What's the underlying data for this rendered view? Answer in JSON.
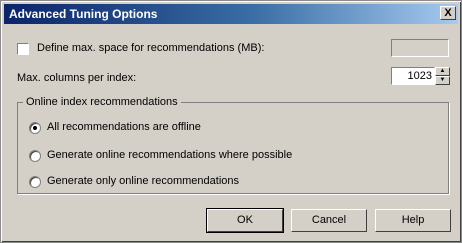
{
  "dialog": {
    "title": "Advanced Tuning Options",
    "close_label": "X"
  },
  "space_option": {
    "label": "Define max. space for recommendations (MB):",
    "checked": false,
    "value": ""
  },
  "columns_option": {
    "label": "Max. columns per index:",
    "value": "1023",
    "up_arrow": "▲",
    "down_arrow": "▼"
  },
  "online_group": {
    "title": "Online index recommendations",
    "options": [
      {
        "label": "All recommendations are offline",
        "selected": true
      },
      {
        "label": "Generate online recommendations where possible",
        "selected": false
      },
      {
        "label": "Generate only online recommendations",
        "selected": false
      }
    ]
  },
  "buttons": {
    "ok": "OK",
    "cancel": "Cancel",
    "help": "Help"
  }
}
